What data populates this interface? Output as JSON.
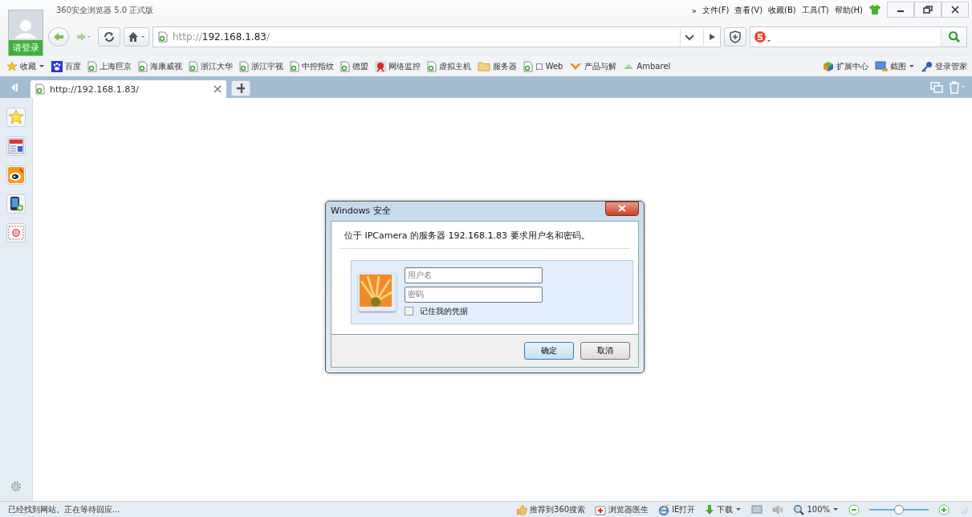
{
  "window": {
    "title": "360安全浏览器 5.0 正式版",
    "login": "请登录"
  },
  "menu": [
    "»",
    "文件(F)",
    "查看(V)",
    "收藏(B)",
    "工具(T)",
    "帮助(H)"
  ],
  "address": {
    "scheme": "http://",
    "host": "192.168.1.83",
    "path": "/"
  },
  "bookmarks": [
    {
      "kind": "favorites",
      "label": "收藏"
    },
    {
      "kind": "baidu",
      "label": "百度"
    },
    {
      "kind": "page",
      "label": "上海巨京"
    },
    {
      "kind": "page",
      "label": "海康威视"
    },
    {
      "kind": "page",
      "label": "浙江大华"
    },
    {
      "kind": "page",
      "label": "浙江宇视"
    },
    {
      "kind": "page",
      "label": "中控指纹"
    },
    {
      "kind": "page",
      "label": "德盟"
    },
    {
      "kind": "monitor",
      "label": "网络监控"
    },
    {
      "kind": "page",
      "label": "虚拟主机"
    },
    {
      "kind": "folder",
      "label": "服务器"
    },
    {
      "kind": "page",
      "label": "□ Web"
    },
    {
      "kind": "product",
      "label": "产品与解"
    },
    {
      "kind": "ambari",
      "label": "Ambarel"
    }
  ],
  "bookmark_tools": [
    {
      "kind": "extensions",
      "label": "扩展中心"
    },
    {
      "kind": "screenshot",
      "label": "截图"
    },
    {
      "kind": "key",
      "label": "登录管家"
    }
  ],
  "tabs": [
    {
      "label": "http://192.168.1.83/",
      "selected": true
    }
  ],
  "sidebar": [
    {
      "kind": "star"
    },
    {
      "kind": "news"
    },
    {
      "kind": "weibo"
    },
    {
      "kind": "phone"
    },
    {
      "kind": "mail"
    }
  ],
  "dialog": {
    "title": "Windows 安全",
    "message": "位于 IPCamera 的服务器 192.168.1.83 要求用户名和密码。",
    "username": {
      "placeholder": "用户名"
    },
    "password": {
      "placeholder": "密码"
    },
    "remember": {
      "label": "记住我的凭据",
      "checked": false
    },
    "buttons": [
      {
        "label": "确定",
        "kind": "default"
      },
      {
        "label": "取消",
        "kind": "normal"
      }
    ]
  },
  "status_bar": {
    "message": "已经找到网站。正在等待回应...",
    "items": [
      {
        "kind": "thumb",
        "label": "推荐到360搜索"
      },
      {
        "kind": "doctor",
        "label": "浏览器医生"
      },
      {
        "kind": "ie",
        "label": "IE打开"
      },
      {
        "kind": "download",
        "label": "下载"
      }
    ],
    "zoom": "100%",
    "zoom_slider": {
      "level": 0.5
    }
  }
}
